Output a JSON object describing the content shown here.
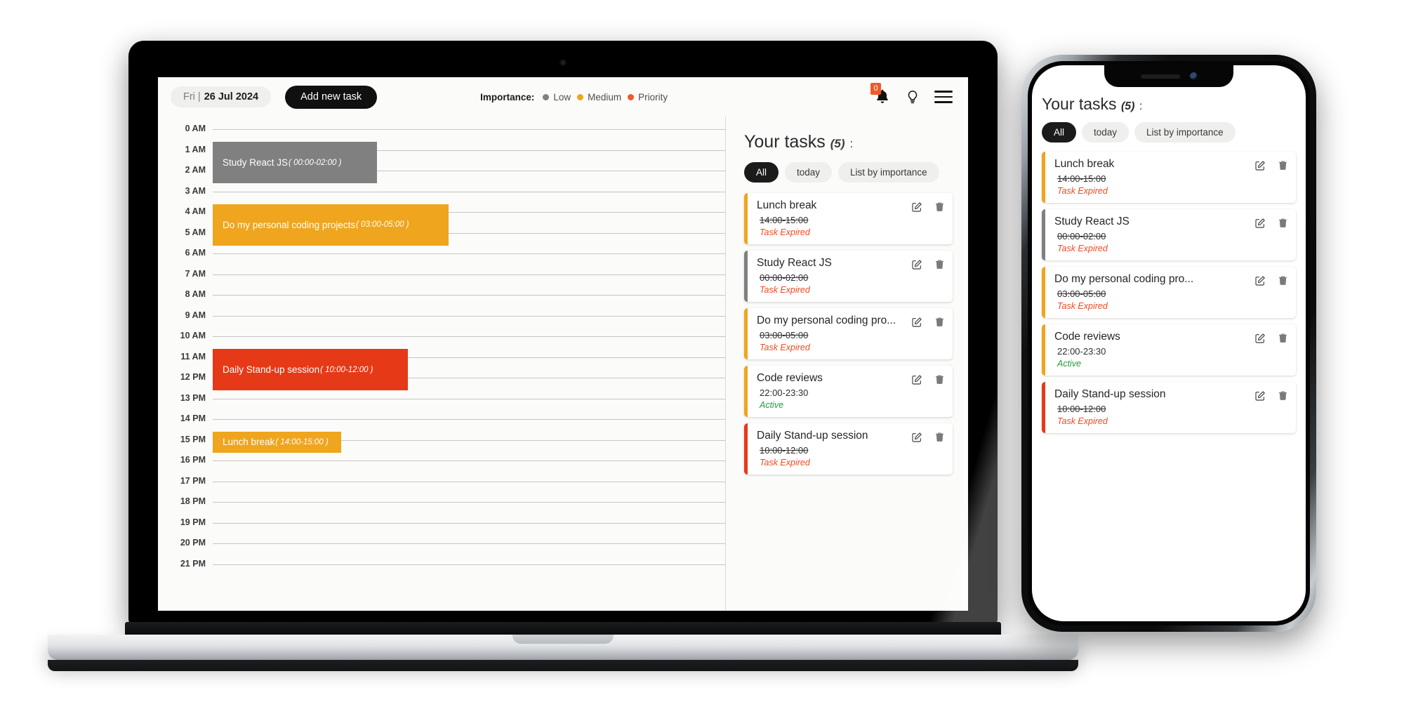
{
  "app": {
    "header": {
      "date_dow": "Fri |",
      "date_value": "26 Jul 2024",
      "add_task_label": "Add new task",
      "importance_label": "Importance:",
      "legend": [
        {
          "label": "Low",
          "color": "#808080"
        },
        {
          "label": "Medium",
          "color": "#efa51d"
        },
        {
          "label": "Priority",
          "color": "#ef5a2b"
        }
      ],
      "notification_count": "0",
      "bell_icon": "bell-icon",
      "idea_icon": "lightbulb-icon",
      "menu_icon": "hamburger-menu-icon"
    },
    "timeline": {
      "hours": [
        "0 AM",
        "1 AM",
        "2 AM",
        "3 AM",
        "4 AM",
        "5 AM",
        "6 AM",
        "7 AM",
        "8 AM",
        "9 AM",
        "10 AM",
        "11 AM",
        "12 PM",
        "13 PM",
        "14 PM",
        "15 PM",
        "16 PM",
        "17 PM",
        "18 PM",
        "19 PM",
        "20 PM",
        "21 PM"
      ],
      "events": [
        {
          "title": "Study React JS",
          "hours": "( 00:00-02:00 )",
          "start": 0,
          "end": 2,
          "width_pct": 32,
          "color": "#808080"
        },
        {
          "title": "Do my personal coding projects",
          "hours": "( 03:00-05:00 )",
          "start": 3,
          "end": 5,
          "width_pct": 46,
          "color": "#efa51d"
        },
        {
          "title": "Daily Stand-up session",
          "hours": "( 10:00-12:00 )",
          "start": 10,
          "end": 12,
          "width_pct": 38,
          "color": "#e63917"
        },
        {
          "title": "Lunch break",
          "hours": "( 14:00-15:00 )",
          "start": 14,
          "end": 15,
          "width_pct": 25,
          "color": "#efa51d"
        }
      ]
    },
    "tasks_panel": {
      "heading": "Your tasks",
      "count": "(5)",
      "colon": ":",
      "filters": [
        {
          "label": "All",
          "active": true
        },
        {
          "label": "today",
          "active": false
        },
        {
          "label": "List by importance",
          "active": false
        }
      ],
      "edit_icon": "edit-icon",
      "delete_icon": "trash-icon",
      "cards": [
        {
          "title": "Lunch break",
          "time": "14:00-15:00",
          "status": "Task Expired",
          "expired": true,
          "accent": "#efa51d"
        },
        {
          "title": "Study React JS",
          "time": "00:00-02:00",
          "status": "Task Expired",
          "expired": true,
          "accent": "#808080"
        },
        {
          "title": "Do my personal coding pro...",
          "time": "03:00-05:00",
          "status": "Task Expired",
          "expired": true,
          "accent": "#efa51d"
        },
        {
          "title": "Code reviews",
          "time": "22:00-23:30",
          "status": "Active",
          "expired": false,
          "accent": "#efa51d"
        },
        {
          "title": "Daily Stand-up session",
          "time": "10:00-12:00",
          "status": "Task Expired",
          "expired": true,
          "accent": "#e63917"
        }
      ]
    }
  },
  "phone": {
    "heading": "Your tasks",
    "count": "(5)",
    "colon": ":",
    "filters": [
      {
        "label": "All",
        "active": true
      },
      {
        "label": "today",
        "active": false
      },
      {
        "label": "List by importance",
        "active": false
      }
    ],
    "cards": [
      {
        "title": "Lunch break",
        "time": "14:00-15:00",
        "status": "Task Expired",
        "expired": true,
        "accent": "#efa51d"
      },
      {
        "title": "Study React JS",
        "time": "00:00-02:00",
        "status": "Task Expired",
        "expired": true,
        "accent": "#808080"
      },
      {
        "title": "Do my personal coding pro...",
        "time": "03:00-05:00",
        "status": "Task Expired",
        "expired": true,
        "accent": "#efa51d"
      },
      {
        "title": "Code reviews",
        "time": "22:00-23:30",
        "status": "Active",
        "expired": false,
        "accent": "#efa51d"
      },
      {
        "title": "Daily Stand-up session",
        "time": "10:00-12:00",
        "status": "Task Expired",
        "expired": true,
        "accent": "#e63917"
      }
    ]
  },
  "theme": {
    "accent_orange": "#efa51d",
    "accent_red": "#e63917",
    "accent_gray": "#808080",
    "expired_color": "#f04a22",
    "active_color": "#1f9b3f",
    "badge_color": "#ef5a2b"
  }
}
